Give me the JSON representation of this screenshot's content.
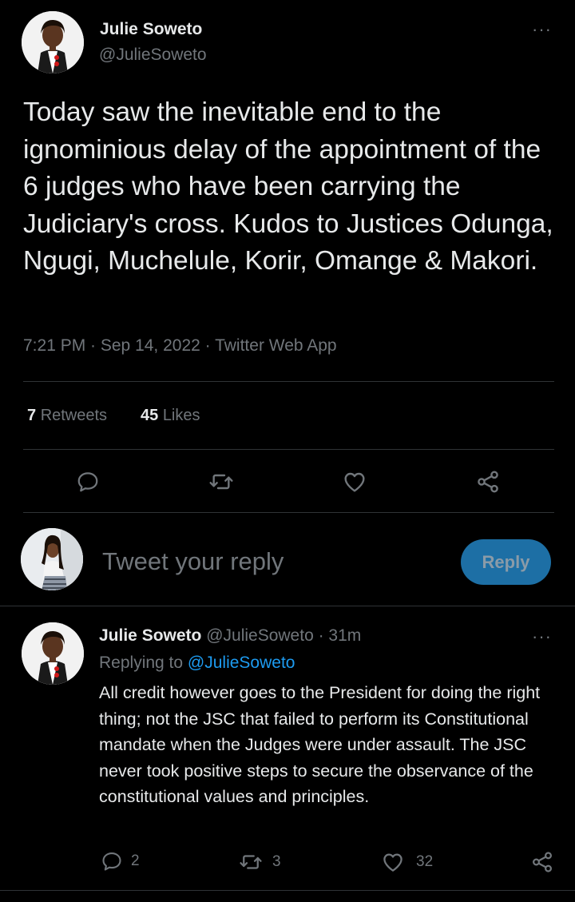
{
  "tweet": {
    "author_name": "Julie Soweto",
    "author_handle": "@JulieSoweto",
    "more_label": "···",
    "text": "Today saw the inevitable end to the ignominious delay of the appointment of the 6 judges who have been carrying the Judiciary's cross. Kudos to Justices Odunga, Ngugi, Muchelule, Korir, Omange & Makori.",
    "timestamp": "7:21 PM · Sep 14, 2022 · Twitter Web App",
    "retweets_count": "7",
    "retweets_label": "Retweets",
    "likes_count": "45",
    "likes_label": "Likes",
    "actions": [
      "reply-icon",
      "retweet-icon",
      "like-icon",
      "share-icon"
    ]
  },
  "composer": {
    "placeholder": "Tweet your reply",
    "button_label": "Reply",
    "button_color": "#1d6fa5"
  },
  "reply": {
    "author_name": "Julie Soweto",
    "author_handle": "@JulieSoweto",
    "time": "· 31m",
    "more_label": "···",
    "replying_prefix": "Replying to",
    "replying_to": "@JulieSoweto",
    "text": "All credit however goes to the President for doing the right thing; not the JSC that failed to perform its Constitutional mandate when the Judges were under assault. The JSC never took positive steps to secure the observance of the constitutional values and principles.",
    "reply_count": "2",
    "retweet_count": "3",
    "like_count": "32"
  },
  "colors": {
    "background": "#000000",
    "text": "#e7e9ea",
    "muted": "#71767b",
    "link": "#1d9bf0",
    "divider": "#2f3336"
  }
}
